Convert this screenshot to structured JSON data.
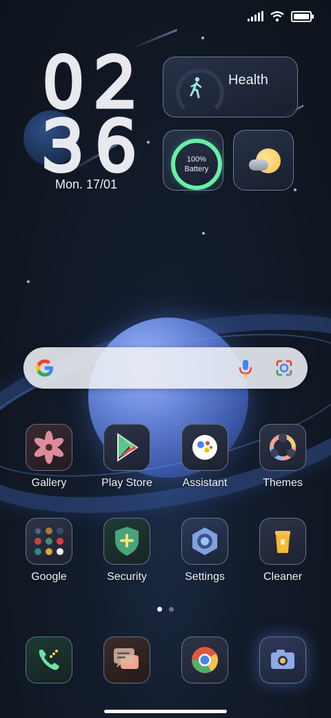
{
  "status_bar": {
    "signal_icon": "signal-bars-icon",
    "wifi_icon": "wifi-icon",
    "battery_icon": "battery-icon",
    "battery_level": 1.0
  },
  "clock": {
    "hour_digits": [
      "0",
      "2"
    ],
    "minute_digits": [
      "3",
      "6"
    ],
    "date": "Mon. 17/01"
  },
  "widgets": {
    "health": {
      "title": "Health",
      "icon": "walking-person-icon"
    },
    "battery": {
      "percent": "100%",
      "label": "Battery"
    },
    "weather": {
      "icon": "partly-sunny-icon"
    }
  },
  "search": {
    "logo": "G",
    "mic_icon": "microphone-icon",
    "lens_icon": "google-lens-icon"
  },
  "apps_row1": [
    {
      "label": "Gallery",
      "icon": "gallery-flower-icon"
    },
    {
      "label": "Play Store",
      "icon": "play-store-icon"
    },
    {
      "label": "Assistant",
      "icon": "assistant-icon"
    },
    {
      "label": "Themes",
      "icon": "themes-icon"
    }
  ],
  "apps_row2": [
    {
      "label": "Google",
      "icon": "google-folder-icon"
    },
    {
      "label": "Security",
      "icon": "security-shield-icon"
    },
    {
      "label": "Settings",
      "icon": "settings-gear-icon"
    },
    {
      "label": "Cleaner",
      "icon": "cleaner-bin-icon"
    }
  ],
  "dock": [
    {
      "icon": "phone-icon"
    },
    {
      "icon": "messages-icon"
    },
    {
      "icon": "chrome-icon"
    },
    {
      "icon": "camera-icon"
    }
  ],
  "page_indicator": {
    "pages": 2,
    "current": 1
  },
  "colors": {
    "battery_ring": "#67f0a6",
    "sun": "#f7c24d",
    "google_blue": "#4285F4",
    "google_red": "#EA4335",
    "google_yellow": "#FBBC05",
    "google_green": "#34A853"
  }
}
